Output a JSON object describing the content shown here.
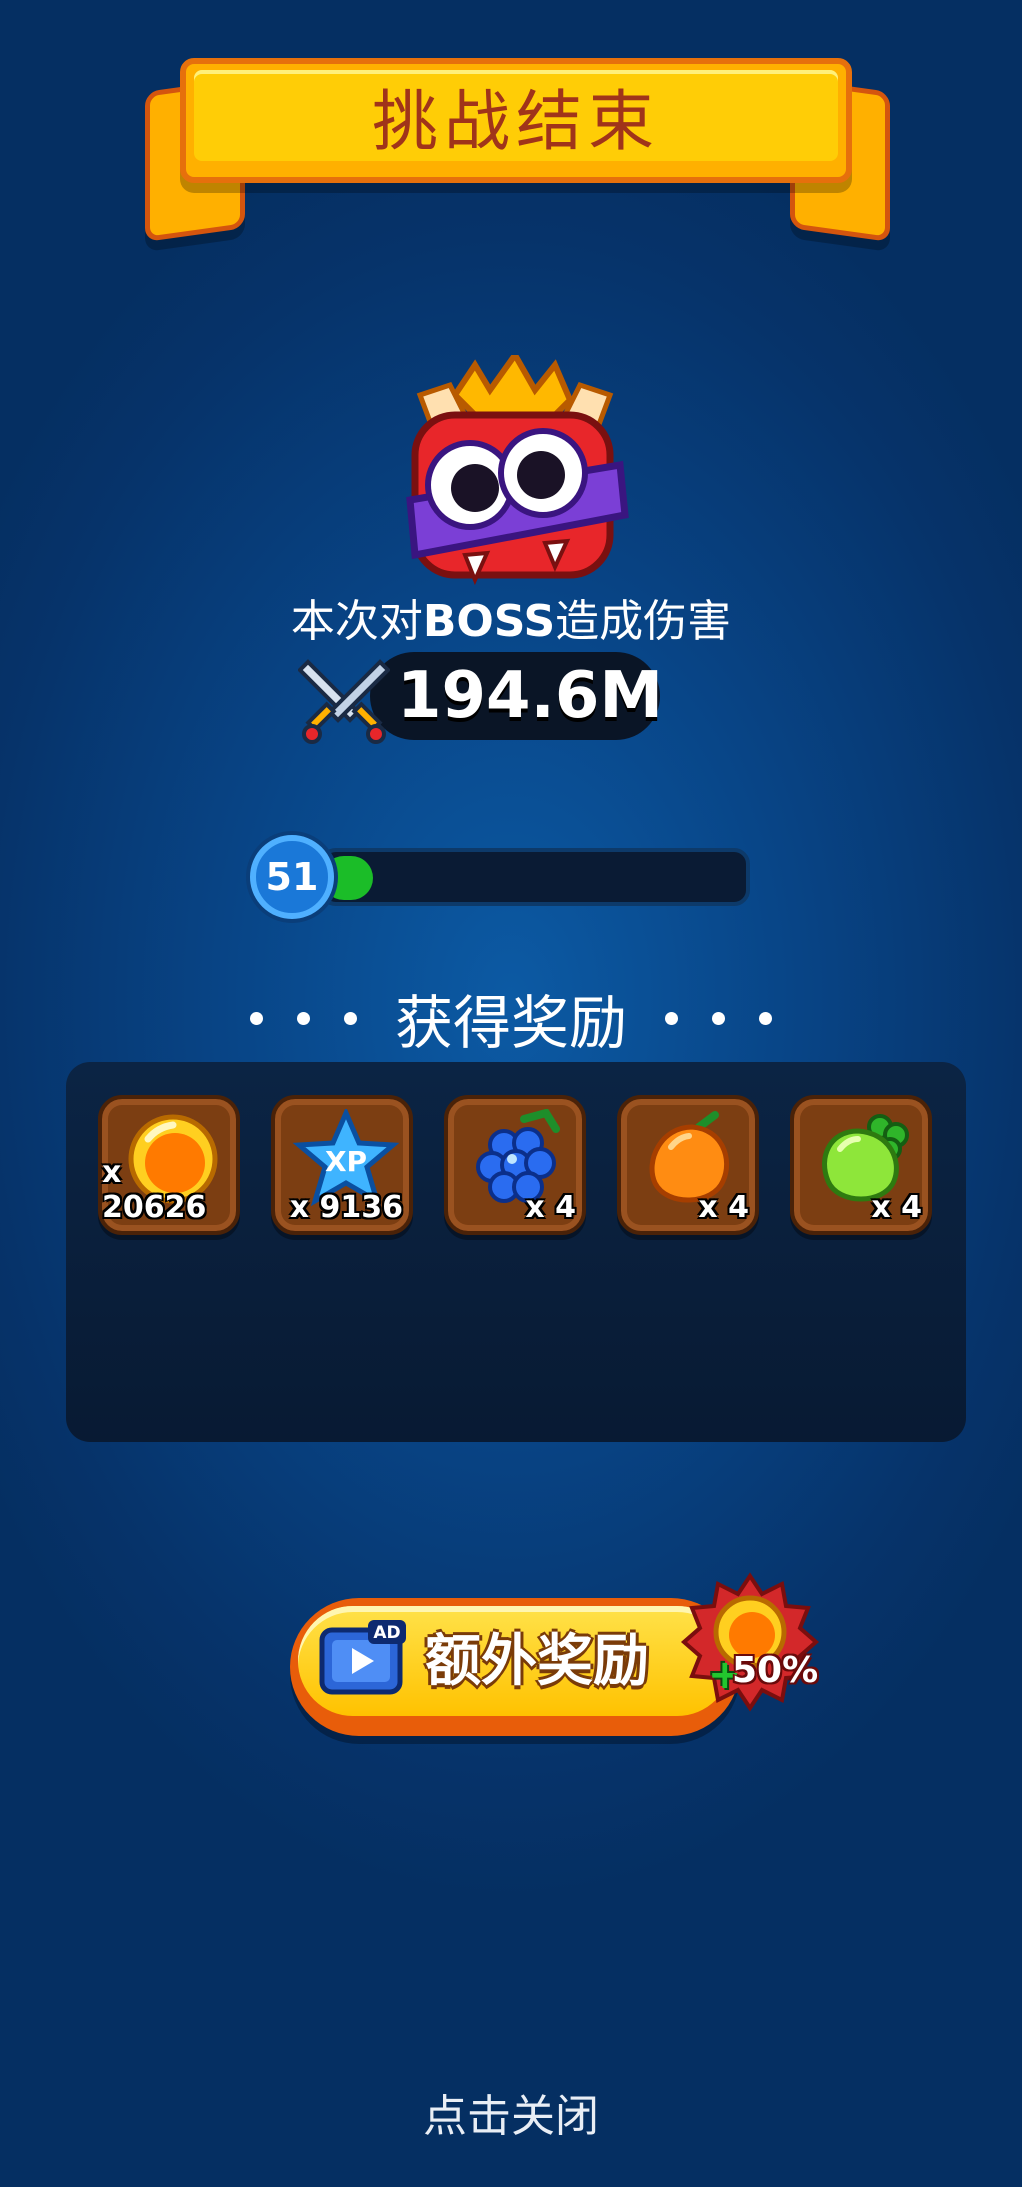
{
  "header": {
    "title": "挑战结束"
  },
  "damage": {
    "caption_prefix": "本次对",
    "caption_boss": "BOSS",
    "caption_suffix": "造成伤害",
    "value": "194.6M"
  },
  "level": {
    "number": "51",
    "progress": 0.05
  },
  "rewards": {
    "title": "获得奖励",
    "items": [
      {
        "icon": "gold-coin-icon",
        "count": "x 20626"
      },
      {
        "icon": "xp-star-icon",
        "count": "x 9136"
      },
      {
        "icon": "grape-icon",
        "count": "x 4"
      },
      {
        "icon": "orange-fruit-icon",
        "count": "x 4"
      },
      {
        "icon": "green-fruit-icon",
        "count": "x 4"
      }
    ]
  },
  "extra_button": {
    "label": "额外奖励",
    "ad_label": "AD",
    "bonus": "50%",
    "bonus_sign": "+"
  },
  "footer": {
    "close_hint": "点击关闭"
  },
  "colors": {
    "banner": "#ffcd06",
    "title_text": "#a0341a",
    "level_fill": "#1bbd28",
    "slot_bg": "#7c3e12"
  }
}
